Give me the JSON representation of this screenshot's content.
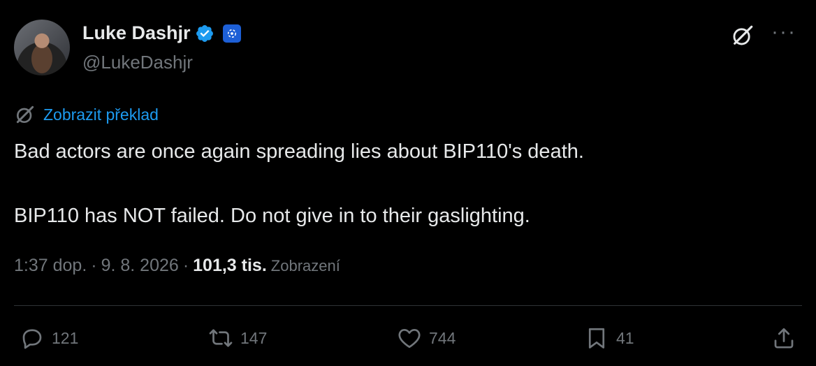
{
  "author": {
    "name": "Luke Dashjr",
    "handle": "@LukeDashjr",
    "avatar_icon": "profile-photo",
    "verified_icon": "verified-badge-icon",
    "affiliation_icon": "affiliation-badge-icon"
  },
  "header": {
    "grok_icon": "grok-icon",
    "more_label": "···"
  },
  "translate": {
    "label": "Zobrazit překlad",
    "icon": "grok-icon"
  },
  "tweet": {
    "paragraphs": [
      "Bad actors are once again spreading lies about BIP110's death.",
      "BIP110 has NOT failed. Do not give in to their gaslighting."
    ]
  },
  "meta": {
    "time": "1:37 dop.",
    "sep1": "·",
    "date": "9. 8. 2026",
    "sep2": "·",
    "views_count": "101,3 tis.",
    "views_label": "Zobrazení"
  },
  "actions": {
    "replies": "121",
    "reposts": "147",
    "likes": "744",
    "bookmarks": "41"
  },
  "colors": {
    "background": "#000000",
    "text": "#e7e9ea",
    "muted": "#71767b",
    "link": "#1d9bf0",
    "verified": "#1d9bf0",
    "divider": "#2f3336"
  }
}
